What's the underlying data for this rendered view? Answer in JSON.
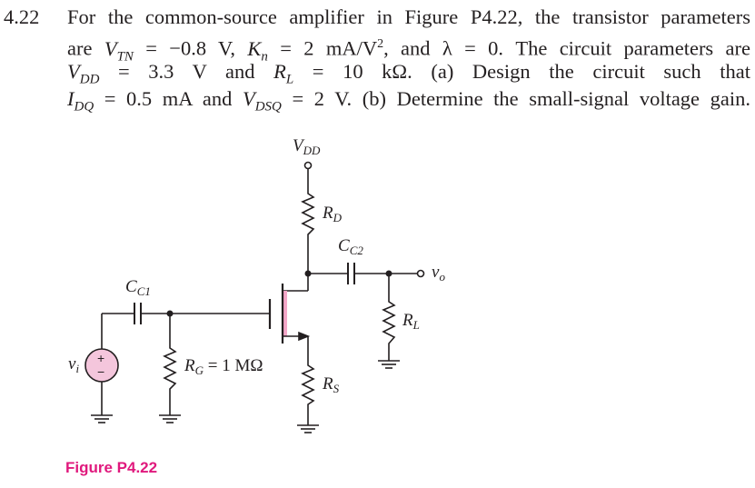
{
  "problem": {
    "number": "4.22",
    "lines": [
      "For the common-source amplifier in Figure P4.22, the transistor parameters",
      "are V_TN = −0.8 V, K_n = 2 mA/V², and λ = 0. The circuit parameters are",
      "V_DD = 3.3 V  and  R_L = 10 kΩ.  (a)  Design  the  circuit  such  that",
      "I_DQ = 0.5 mA and V_DSQ = 2 V. (b) Determine the small-signal voltage gain."
    ]
  },
  "figure": {
    "caption": "Figure P4.22",
    "caption_color": "#e0197d",
    "highlight_color": "#f4a7c8",
    "labels": {
      "vdd": "V",
      "vdd_sub": "DD",
      "rd": "R",
      "rd_sub": "D",
      "cc2": "C",
      "cc2_sub": "C2",
      "vo": "v",
      "vo_sub": "o",
      "cc1": "C",
      "cc1_sub": "C1",
      "rl": "R",
      "rl_sub": "L",
      "vi": "v",
      "vi_sub": "i",
      "rg": "R",
      "rg_sub": "G",
      "rg_value": " = 1 MΩ",
      "rs": "R",
      "rs_sub": "S",
      "plus": "+",
      "minus": "−"
    }
  }
}
